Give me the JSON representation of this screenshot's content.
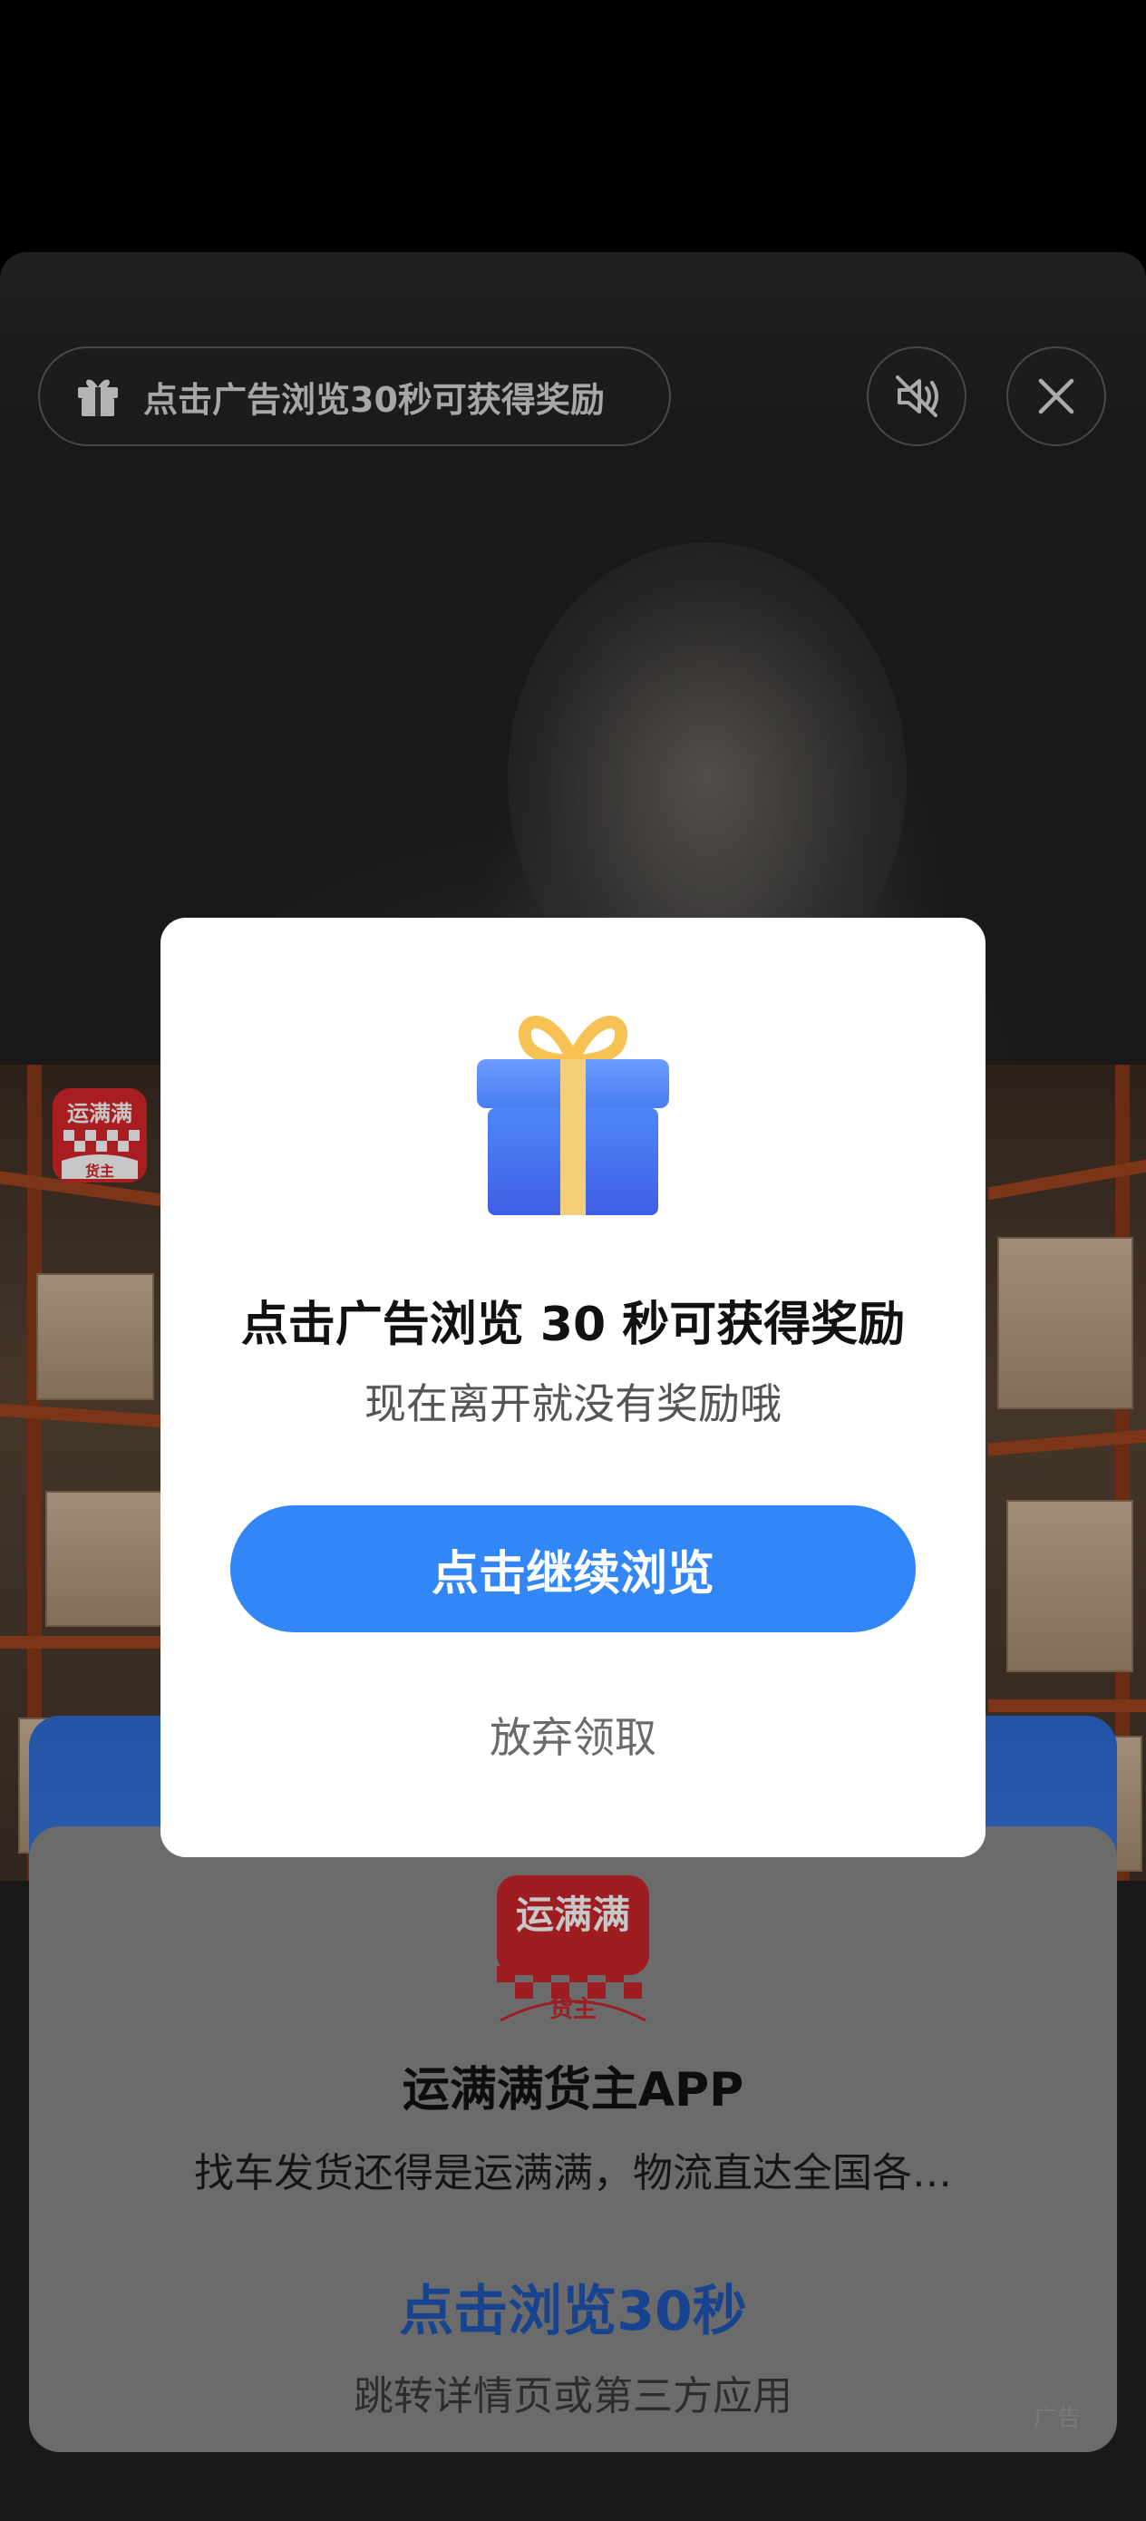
{
  "top_bar": {
    "reward_hint": "点击广告浏览30秒可获得奖励",
    "mute_icon": "speaker-muted-icon",
    "close_icon": "close-icon"
  },
  "ad": {
    "brand_badge_text_top": "运满满",
    "brand_badge_text_bottom": "货主",
    "app_name": "运满满货主APP",
    "app_description": "找车发货还得是运满满，物流直达全国各…",
    "cta": "点击浏览30秒",
    "cta_hint": "跳转详情页或第三方应用",
    "ad_label": "广告"
  },
  "dialog": {
    "title": "点击广告浏览 30 秒可获得奖励",
    "subtitle": "现在离开就没有奖励哦",
    "continue_label": "点击继续浏览",
    "abandon_label": "放弃领取"
  },
  "colors": {
    "primary_button": "#3286f5",
    "cta_text": "#1f57b8",
    "brand_red": "#d8262a",
    "gift_blue": "#3f72ee",
    "gift_ribbon": "#f3cf7a"
  }
}
